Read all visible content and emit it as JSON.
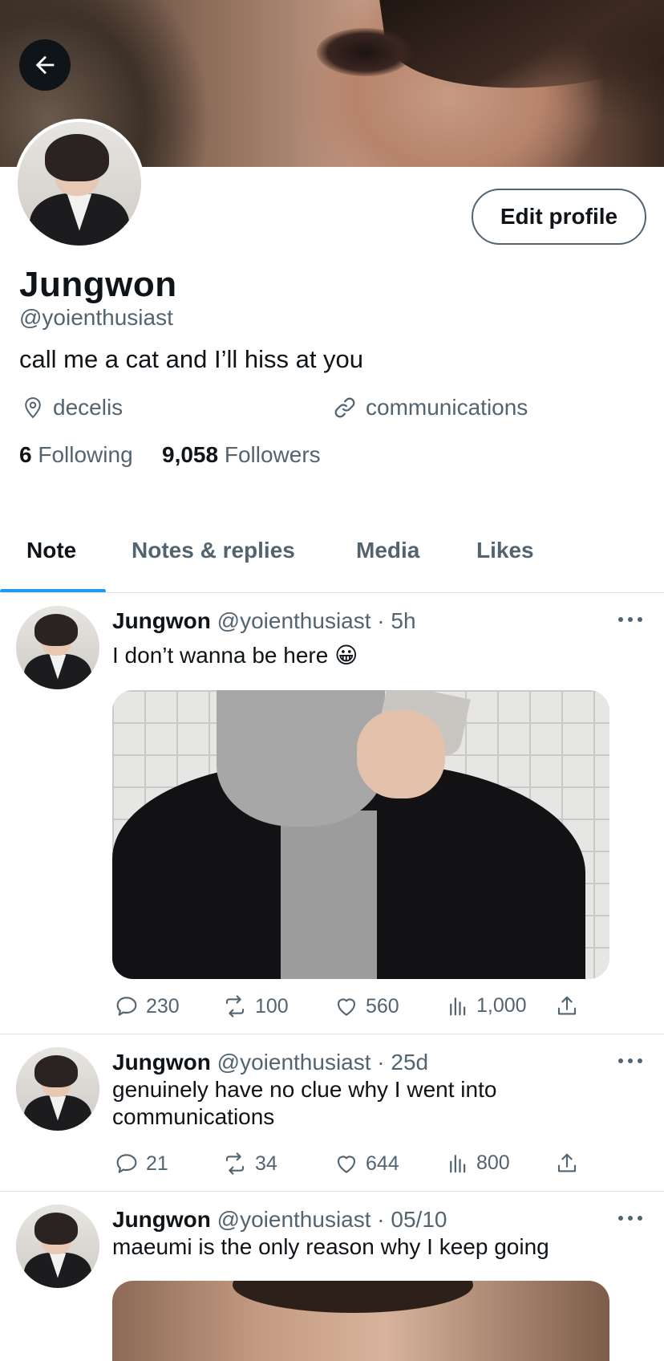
{
  "header": {
    "back_icon": "arrow-left-icon"
  },
  "profile": {
    "name": "Jungwon",
    "handle": "@yoienthusiast",
    "bio": "call me a cat and I’ll hiss at you",
    "location": "decelis",
    "link": "communications",
    "following_count": "6",
    "following_label": "Following",
    "followers_count": "9,058",
    "followers_label": "Followers",
    "edit_label": "Edit profile"
  },
  "tabs": [
    {
      "label": "Note",
      "active": true
    },
    {
      "label": "Notes & replies",
      "active": false
    },
    {
      "label": "Media",
      "active": false
    },
    {
      "label": "Likes",
      "active": false
    }
  ],
  "posts": [
    {
      "name": "Jungwon",
      "handle": "@yoienthusiast",
      "sep": "·",
      "time": "5h",
      "text": "I don’t wanna be here 😀",
      "has_media": true,
      "replies": "230",
      "reposts": "100",
      "likes": "560",
      "views": "1,000"
    },
    {
      "name": "Jungwon",
      "handle": "@yoienthusiast",
      "sep": "·",
      "time": "25d",
      "text": "genuinely have no clue why I went into communications",
      "has_media": false,
      "replies": "21",
      "reposts": "34",
      "likes": "644",
      "views": "800"
    },
    {
      "name": "Jungwon",
      "handle": "@yoienthusiast",
      "sep": "·",
      "time": "05/10",
      "text": "maeumi is the only reason why I keep going",
      "has_media": true
    }
  ],
  "colors": {
    "accent": "#1d9bf0",
    "muted": "#536471",
    "text": "#0f1419"
  }
}
